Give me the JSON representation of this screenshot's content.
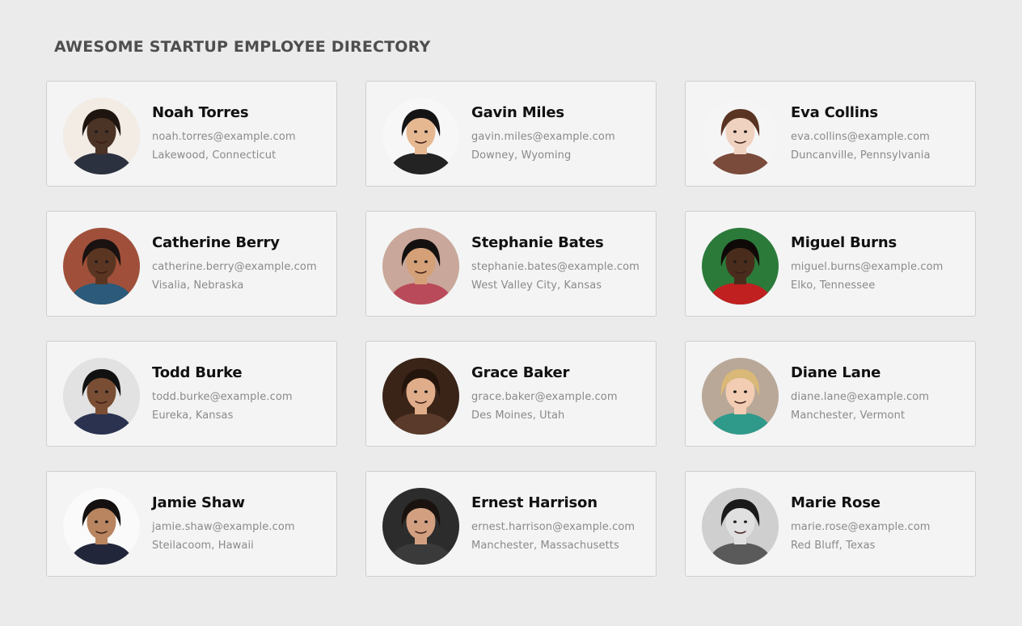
{
  "page": {
    "title": "AWESOME STARTUP EMPLOYEE DIRECTORY"
  },
  "employees": [
    {
      "name": "Noah Torres",
      "email": "noah.torres@example.com",
      "location": "Lakewood, Connecticut",
      "avatar": {
        "bg": "#f3ece4",
        "skin": "#4b3326",
        "hair": "#1e1410",
        "shirt": "#2c3140"
      }
    },
    {
      "name": "Gavin Miles",
      "email": "gavin.miles@example.com",
      "location": "Downey, Wyoming",
      "avatar": {
        "bg": "#f7f7f7",
        "skin": "#e6b892",
        "hair": "#141414",
        "shirt": "#232323"
      }
    },
    {
      "name": "Eva Collins",
      "email": "eva.collins@example.com",
      "location": "Duncanville, Pennsylvania",
      "avatar": {
        "bg": "#f5f5f5",
        "skin": "#f0d2c0",
        "hair": "#5a3423",
        "shirt": "#7a4a3a"
      }
    },
    {
      "name": "Catherine Berry",
      "email": "catherine.berry@example.com",
      "location": "Visalia, Nebraska",
      "avatar": {
        "bg": "#a0503a",
        "skin": "#5a3522",
        "hair": "#1a1210",
        "shirt": "#2b5a7a"
      }
    },
    {
      "name": "Stephanie Bates",
      "email": "stephanie.bates@example.com",
      "location": "West Valley City, Kansas",
      "avatar": {
        "bg": "#c9a79a",
        "skin": "#d4a077",
        "hair": "#141010",
        "shirt": "#b84a5a"
      }
    },
    {
      "name": "Miguel Burns",
      "email": "miguel.burns@example.com",
      "location": "Elko, Tennessee",
      "avatar": {
        "bg": "#2b7a3a",
        "skin": "#4a2c1c",
        "hair": "#0f0a08",
        "shirt": "#c02020"
      }
    },
    {
      "name": "Todd Burke",
      "email": "todd.burke@example.com",
      "location": "Eureka, Kansas",
      "avatar": {
        "bg": "#e2e2e2",
        "skin": "#7a4e34",
        "hair": "#111111",
        "shirt": "#2a3250"
      }
    },
    {
      "name": "Grace Baker",
      "email": "grace.baker@example.com",
      "location": "Des Moines, Utah",
      "avatar": {
        "bg": "#3a2418",
        "skin": "#e0ad8a",
        "hair": "#23140c",
        "shirt": "#5a3a2a"
      }
    },
    {
      "name": "Diane Lane",
      "email": "diane.lane@example.com",
      "location": "Manchester, Vermont",
      "avatar": {
        "bg": "#b9a898",
        "skin": "#f2cdb3",
        "hair": "#d9b878",
        "shirt": "#2f9a8a"
      }
    },
    {
      "name": "Jamie Shaw",
      "email": "jamie.shaw@example.com",
      "location": "Steilacoom, Hawaii",
      "avatar": {
        "bg": "#fafafa",
        "skin": "#b88560",
        "hair": "#141010",
        "shirt": "#22263a"
      }
    },
    {
      "name": "Ernest Harrison",
      "email": "ernest.harrison@example.com",
      "location": "Manchester, Massachusetts",
      "avatar": {
        "bg": "#2c2c2c",
        "skin": "#d2a080",
        "hair": "#1a120e",
        "shirt": "#3a3a3a"
      }
    },
    {
      "name": "Marie Rose",
      "email": "marie.rose@example.com",
      "location": "Red Bluff, Texas",
      "avatar": {
        "bg": "#cfcfcf",
        "skin": "#e0e0e0",
        "hair": "#1a1a1a",
        "shirt": "#5a5a5a"
      }
    }
  ]
}
